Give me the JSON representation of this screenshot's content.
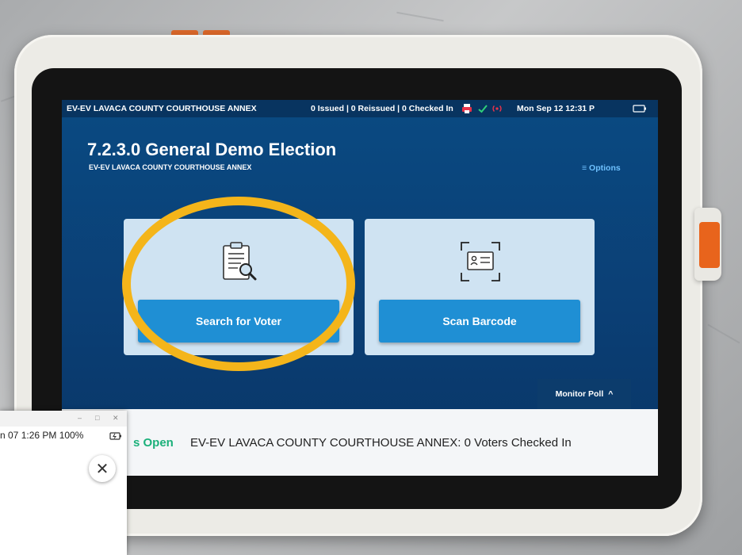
{
  "statusbar": {
    "location": "EV-EV LAVACA COUNTY COURTHOUSE ANNEX",
    "counts": "0 Issued | 0 Reissued | 0 Checked In",
    "datetime": "Mon Sep 12  12:31 P",
    "icons": [
      "printer-icon",
      "check-icon",
      "signal-icon",
      "battery-icon"
    ]
  },
  "header": {
    "title": "7.2.3.0 General Demo Election",
    "subtitle": "EV-EV LAVACA COUNTY COURTHOUSE ANNEX",
    "options_label": "≡ Options"
  },
  "cards": {
    "search": {
      "icon": "clipboard-search-icon",
      "button_label": "Search for Voter"
    },
    "scan": {
      "icon": "id-card-scan-icon",
      "button_label": "Scan Barcode"
    }
  },
  "monitor": {
    "label": "Monitor Poll",
    "chevron": "^"
  },
  "bottom": {
    "polls_status": "s Open",
    "voters_checked_in": "EV-EV LAVACA COUNTY COURTHOUSE ANNEX: 0 Voters Checked In"
  },
  "overlay": {
    "clock": "n 07  1:26 PM  100%",
    "window_controls": [
      "–",
      "□",
      "✕"
    ],
    "close_glyph": "✕"
  },
  "colors": {
    "screen_blue": "#0b3f75",
    "button_blue": "#1f8fd4",
    "card_bg": "#cfe3f2",
    "polls_green": "#1bb07a",
    "annotation_yellow": "#f4b51a",
    "side_button_orange": "#e8641c"
  }
}
